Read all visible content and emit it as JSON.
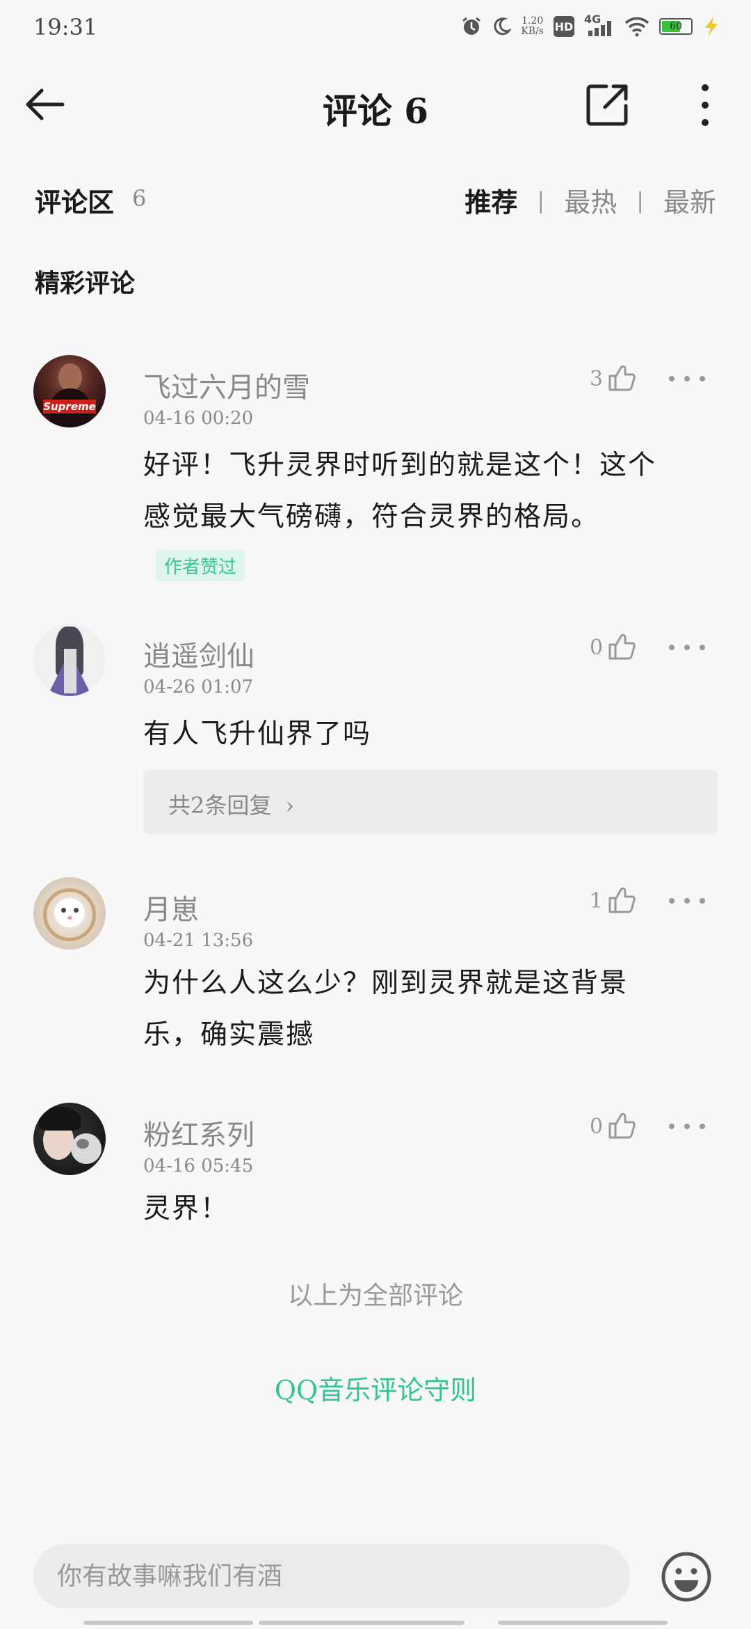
{
  "status_bar": {
    "time": "19:31",
    "net_speed_value": "1.20",
    "net_speed_unit": "KB/s",
    "hd_label": "HD",
    "network_label": "4G",
    "battery_level": "60",
    "icons": [
      "alarm-icon",
      "moon-icon",
      "hd-icon",
      "signal-icon",
      "wifi-icon",
      "battery-icon",
      "charging-icon"
    ]
  },
  "header": {
    "title": "评论 6"
  },
  "section": {
    "title": "评论区",
    "count": "6",
    "tabs": [
      "推荐",
      "最热",
      "最新"
    ],
    "active_tab": "推荐"
  },
  "featured_label": "精彩评论",
  "comments": [
    {
      "username": "飞过六月的雪",
      "time": "04-16 00:20",
      "likes": "3",
      "text_lines": [
        "好评！飞升灵界时听到的就是这个！这个",
        "感觉最大气磅礴，符合灵界的格局。"
      ],
      "badge": "作者赞过",
      "avatar_text": "Supreme"
    },
    {
      "username": "逍遥剑仙",
      "time": "04-26 01:07",
      "likes": "0",
      "text_lines": [
        "有人飞升仙界了吗"
      ],
      "replies_label": "共2条回复"
    },
    {
      "username": "月崽",
      "time": "04-21 13:56",
      "likes": "1",
      "text_lines": [
        "为什么人这么少？刚到灵界就是这背景",
        "乐，确实震撼"
      ]
    },
    {
      "username": "粉红系列",
      "time": "04-16 05:45",
      "likes": "0",
      "text_lines": [
        "灵界！"
      ]
    }
  ],
  "footer": {
    "all_comments_text": "以上为全部评论",
    "guidelines_link": "QQ音乐评论守则"
  },
  "input": {
    "placeholder": "你有故事嘛我们有酒"
  },
  "colors": {
    "accent_green": "#32c397",
    "background": "#f7f7f7",
    "battery_green": "#39c23a"
  }
}
